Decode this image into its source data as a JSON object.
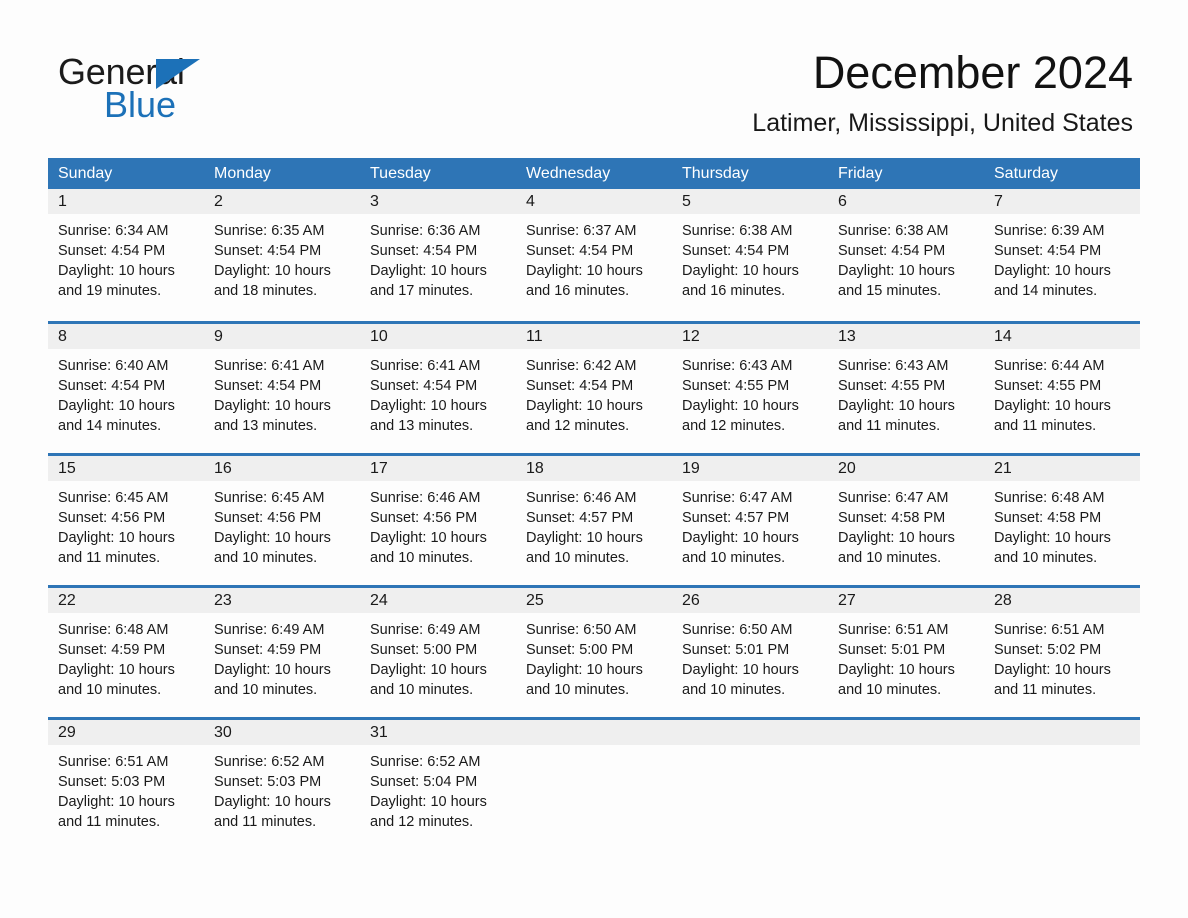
{
  "brand": {
    "line1": "General",
    "line2": "Blue",
    "triangle_color": "#1c71b8"
  },
  "header": {
    "month_title": "December 2024",
    "location": "Latimer, Mississippi, United States"
  },
  "theme": {
    "header_blue": "#2e75b6",
    "day_band_gray": "#efefef",
    "page_background": "#fdfdfd",
    "text_color": "#1a1a1a"
  },
  "weekdays": [
    "Sunday",
    "Monday",
    "Tuesday",
    "Wednesday",
    "Thursday",
    "Friday",
    "Saturday"
  ],
  "weeks": [
    [
      {
        "day": "1",
        "sunrise": "Sunrise: 6:34 AM",
        "sunset": "Sunset: 4:54 PM",
        "daylight1": "Daylight: 10 hours",
        "daylight2": "and 19 minutes."
      },
      {
        "day": "2",
        "sunrise": "Sunrise: 6:35 AM",
        "sunset": "Sunset: 4:54 PM",
        "daylight1": "Daylight: 10 hours",
        "daylight2": "and 18 minutes."
      },
      {
        "day": "3",
        "sunrise": "Sunrise: 6:36 AM",
        "sunset": "Sunset: 4:54 PM",
        "daylight1": "Daylight: 10 hours",
        "daylight2": "and 17 minutes."
      },
      {
        "day": "4",
        "sunrise": "Sunrise: 6:37 AM",
        "sunset": "Sunset: 4:54 PM",
        "daylight1": "Daylight: 10 hours",
        "daylight2": "and 16 minutes."
      },
      {
        "day": "5",
        "sunrise": "Sunrise: 6:38 AM",
        "sunset": "Sunset: 4:54 PM",
        "daylight1": "Daylight: 10 hours",
        "daylight2": "and 16 minutes."
      },
      {
        "day": "6",
        "sunrise": "Sunrise: 6:38 AM",
        "sunset": "Sunset: 4:54 PM",
        "daylight1": "Daylight: 10 hours",
        "daylight2": "and 15 minutes."
      },
      {
        "day": "7",
        "sunrise": "Sunrise: 6:39 AM",
        "sunset": "Sunset: 4:54 PM",
        "daylight1": "Daylight: 10 hours",
        "daylight2": "and 14 minutes."
      }
    ],
    [
      {
        "day": "8",
        "sunrise": "Sunrise: 6:40 AM",
        "sunset": "Sunset: 4:54 PM",
        "daylight1": "Daylight: 10 hours",
        "daylight2": "and 14 minutes."
      },
      {
        "day": "9",
        "sunrise": "Sunrise: 6:41 AM",
        "sunset": "Sunset: 4:54 PM",
        "daylight1": "Daylight: 10 hours",
        "daylight2": "and 13 minutes."
      },
      {
        "day": "10",
        "sunrise": "Sunrise: 6:41 AM",
        "sunset": "Sunset: 4:54 PM",
        "daylight1": "Daylight: 10 hours",
        "daylight2": "and 13 minutes."
      },
      {
        "day": "11",
        "sunrise": "Sunrise: 6:42 AM",
        "sunset": "Sunset: 4:54 PM",
        "daylight1": "Daylight: 10 hours",
        "daylight2": "and 12 minutes."
      },
      {
        "day": "12",
        "sunrise": "Sunrise: 6:43 AM",
        "sunset": "Sunset: 4:55 PM",
        "daylight1": "Daylight: 10 hours",
        "daylight2": "and 12 minutes."
      },
      {
        "day": "13",
        "sunrise": "Sunrise: 6:43 AM",
        "sunset": "Sunset: 4:55 PM",
        "daylight1": "Daylight: 10 hours",
        "daylight2": "and 11 minutes."
      },
      {
        "day": "14",
        "sunrise": "Sunrise: 6:44 AM",
        "sunset": "Sunset: 4:55 PM",
        "daylight1": "Daylight: 10 hours",
        "daylight2": "and 11 minutes."
      }
    ],
    [
      {
        "day": "15",
        "sunrise": "Sunrise: 6:45 AM",
        "sunset": "Sunset: 4:56 PM",
        "daylight1": "Daylight: 10 hours",
        "daylight2": "and 11 minutes."
      },
      {
        "day": "16",
        "sunrise": "Sunrise: 6:45 AM",
        "sunset": "Sunset: 4:56 PM",
        "daylight1": "Daylight: 10 hours",
        "daylight2": "and 10 minutes."
      },
      {
        "day": "17",
        "sunrise": "Sunrise: 6:46 AM",
        "sunset": "Sunset: 4:56 PM",
        "daylight1": "Daylight: 10 hours",
        "daylight2": "and 10 minutes."
      },
      {
        "day": "18",
        "sunrise": "Sunrise: 6:46 AM",
        "sunset": "Sunset: 4:57 PM",
        "daylight1": "Daylight: 10 hours",
        "daylight2": "and 10 minutes."
      },
      {
        "day": "19",
        "sunrise": "Sunrise: 6:47 AM",
        "sunset": "Sunset: 4:57 PM",
        "daylight1": "Daylight: 10 hours",
        "daylight2": "and 10 minutes."
      },
      {
        "day": "20",
        "sunrise": "Sunrise: 6:47 AM",
        "sunset": "Sunset: 4:58 PM",
        "daylight1": "Daylight: 10 hours",
        "daylight2": "and 10 minutes."
      },
      {
        "day": "21",
        "sunrise": "Sunrise: 6:48 AM",
        "sunset": "Sunset: 4:58 PM",
        "daylight1": "Daylight: 10 hours",
        "daylight2": "and 10 minutes."
      }
    ],
    [
      {
        "day": "22",
        "sunrise": "Sunrise: 6:48 AM",
        "sunset": "Sunset: 4:59 PM",
        "daylight1": "Daylight: 10 hours",
        "daylight2": "and 10 minutes."
      },
      {
        "day": "23",
        "sunrise": "Sunrise: 6:49 AM",
        "sunset": "Sunset: 4:59 PM",
        "daylight1": "Daylight: 10 hours",
        "daylight2": "and 10 minutes."
      },
      {
        "day": "24",
        "sunrise": "Sunrise: 6:49 AM",
        "sunset": "Sunset: 5:00 PM",
        "daylight1": "Daylight: 10 hours",
        "daylight2": "and 10 minutes."
      },
      {
        "day": "25",
        "sunrise": "Sunrise: 6:50 AM",
        "sunset": "Sunset: 5:00 PM",
        "daylight1": "Daylight: 10 hours",
        "daylight2": "and 10 minutes."
      },
      {
        "day": "26",
        "sunrise": "Sunrise: 6:50 AM",
        "sunset": "Sunset: 5:01 PM",
        "daylight1": "Daylight: 10 hours",
        "daylight2": "and 10 minutes."
      },
      {
        "day": "27",
        "sunrise": "Sunrise: 6:51 AM",
        "sunset": "Sunset: 5:01 PM",
        "daylight1": "Daylight: 10 hours",
        "daylight2": "and 10 minutes."
      },
      {
        "day": "28",
        "sunrise": "Sunrise: 6:51 AM",
        "sunset": "Sunset: 5:02 PM",
        "daylight1": "Daylight: 10 hours",
        "daylight2": "and 11 minutes."
      }
    ],
    [
      {
        "day": "29",
        "sunrise": "Sunrise: 6:51 AM",
        "sunset": "Sunset: 5:03 PM",
        "daylight1": "Daylight: 10 hours",
        "daylight2": "and 11 minutes."
      },
      {
        "day": "30",
        "sunrise": "Sunrise: 6:52 AM",
        "sunset": "Sunset: 5:03 PM",
        "daylight1": "Daylight: 10 hours",
        "daylight2": "and 11 minutes."
      },
      {
        "day": "31",
        "sunrise": "Sunrise: 6:52 AM",
        "sunset": "Sunset: 5:04 PM",
        "daylight1": "Daylight: 10 hours",
        "daylight2": "and 12 minutes."
      },
      {
        "day": "",
        "sunrise": "",
        "sunset": "",
        "daylight1": "",
        "daylight2": ""
      },
      {
        "day": "",
        "sunrise": "",
        "sunset": "",
        "daylight1": "",
        "daylight2": ""
      },
      {
        "day": "",
        "sunrise": "",
        "sunset": "",
        "daylight1": "",
        "daylight2": ""
      },
      {
        "day": "",
        "sunrise": "",
        "sunset": "",
        "daylight1": "",
        "daylight2": ""
      }
    ]
  ]
}
